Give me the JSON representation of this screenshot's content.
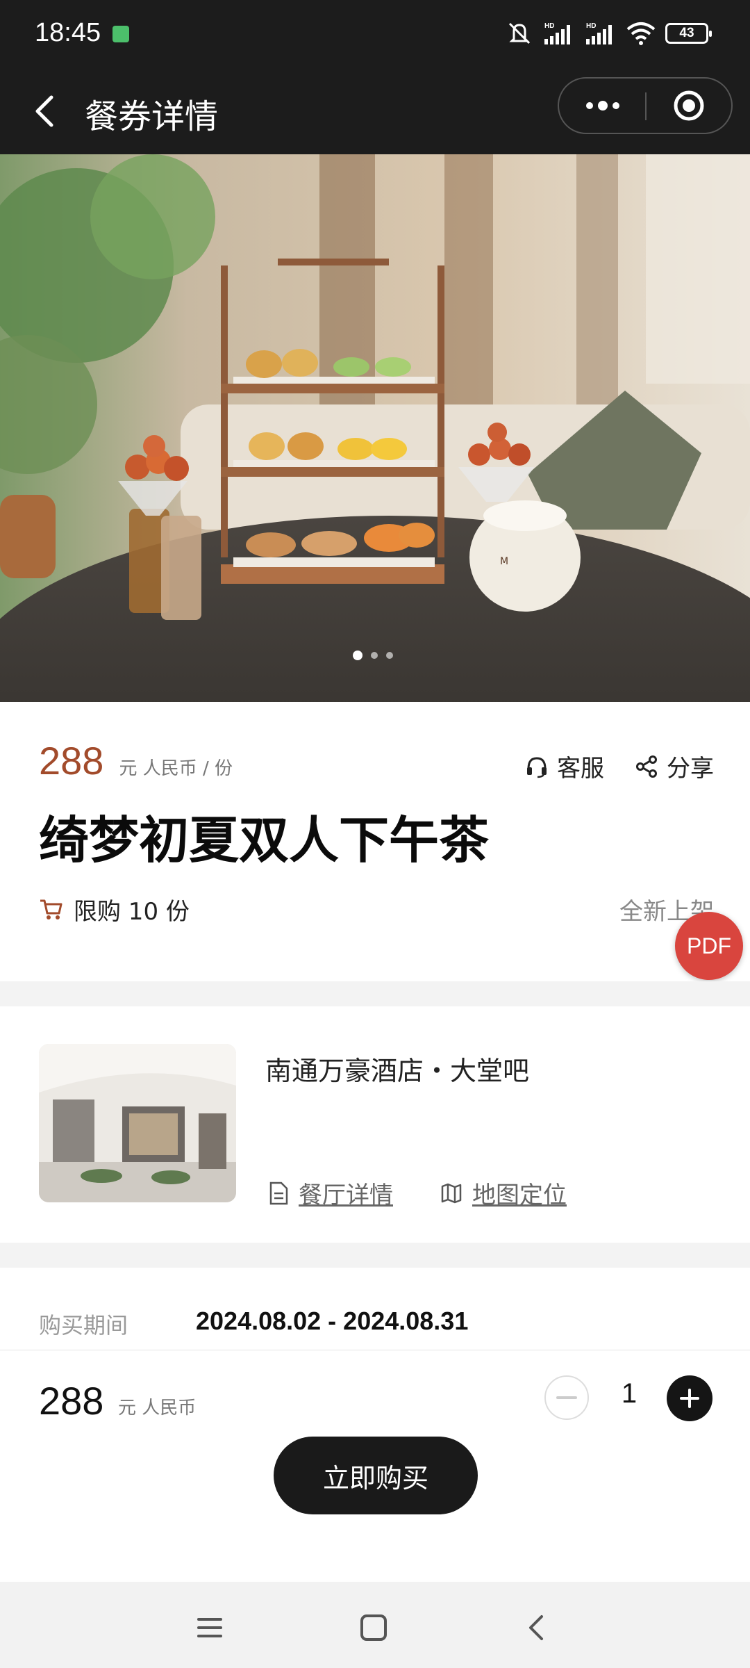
{
  "status_bar": {
    "time": "18:45",
    "battery": "43"
  },
  "nav": {
    "title": "餐券详情",
    "more_icon": "more-dots-icon",
    "close_icon": "mini-program-close-icon"
  },
  "hero": {
    "slide_count": 3,
    "active_slide": 1
  },
  "product": {
    "price": "288",
    "price_unit": "元 人民币 / 份",
    "service_label": "客服",
    "share_label": "分享",
    "title": "绮梦初夏双人下午茶",
    "limit_label": "限购 10 份",
    "new_label": "全新上架",
    "pdf_label": "PDF"
  },
  "restaurant": {
    "name": "南通万豪酒店・大堂吧",
    "details_link": "餐厅详情",
    "map_link": "地图定位"
  },
  "purchase_period": {
    "label": "购买期间",
    "value": "2024.08.02 - 2024.08.31"
  },
  "bottom_bar": {
    "price": "288",
    "unit": "元 人民币",
    "quantity": "1",
    "buy_label": "立即购买"
  },
  "colors": {
    "price_accent": "#a24b2b",
    "pdf_fab": "#d9453e",
    "dark": "#1a1a1a"
  }
}
